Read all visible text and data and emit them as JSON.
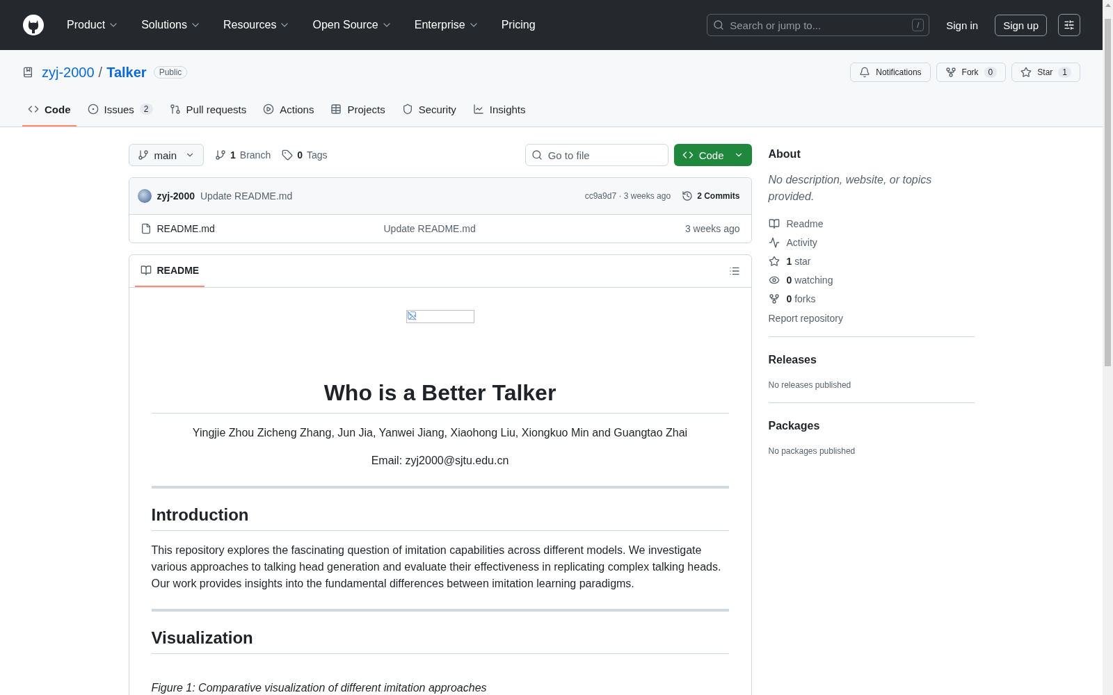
{
  "top_nav": {
    "items": [
      {
        "label": "Product",
        "dropdown": true
      },
      {
        "label": "Solutions",
        "dropdown": true
      },
      {
        "label": "Resources",
        "dropdown": true
      },
      {
        "label": "Open Source",
        "dropdown": true
      },
      {
        "label": "Enterprise",
        "dropdown": true
      },
      {
        "label": "Pricing",
        "dropdown": false
      }
    ],
    "search": {
      "placeholder": "Search or jump to...",
      "shortcut": "/"
    },
    "sign_in": "Sign in",
    "sign_up": "Sign up"
  },
  "repo": {
    "owner": "zyj-2000",
    "separator": "/",
    "name": "Talker",
    "visibility": "Public",
    "actions": [
      {
        "kind": "notifications",
        "label": "Notifications"
      },
      {
        "kind": "fork",
        "label": "Fork",
        "count": "0"
      },
      {
        "kind": "star",
        "label": "Star",
        "count": "1"
      }
    ],
    "tabs": [
      {
        "kind": "code",
        "label": "Code",
        "selected": true
      },
      {
        "kind": "issues",
        "label": "Issues",
        "count": "2",
        "selected": false
      },
      {
        "kind": "pulls",
        "label": "Pull requests",
        "selected": false
      },
      {
        "kind": "actions",
        "label": "Actions",
        "selected": false
      },
      {
        "kind": "projects",
        "label": "Projects",
        "selected": false
      },
      {
        "kind": "security",
        "label": "Security",
        "selected": false
      },
      {
        "kind": "insights",
        "label": "Insights",
        "selected": false
      }
    ]
  },
  "file_nav": {
    "branch": "main",
    "branches": {
      "count": "1",
      "label": "Branch"
    },
    "tags": {
      "count": "0",
      "label": "Tags"
    },
    "go_to_file": {
      "placeholder": "Go to file"
    },
    "code_button": "Code"
  },
  "latest_commit": {
    "author": "zyj-2000",
    "message": "Update README.md",
    "hash": "cc9a9d7",
    "separator": "·",
    "time": "3 weeks ago",
    "commits": "2 Commits"
  },
  "files": [
    {
      "name": "README.md",
      "message": "Update README.md",
      "time": "3 weeks ago"
    }
  ],
  "readme": {
    "tab": "README",
    "title": "Who is a Better Talker",
    "authors": "Yingjie Zhou Zicheng Zhang, Jun Jia, Yanwei Jiang, Xiaohong Liu, Xiongkuo Min and Guangtao Zhai",
    "email": "Email: zyj2000@sjtu.edu.cn",
    "sections": [
      {
        "heading": "Introduction",
        "body": "This repository explores the fascinating question of imitation capabilities across different models. We investigate various approaches to talking head generation and evaluate their effectiveness in replicating complex talking heads. Our work provides insights into the fundamental differences between imitation learning paradigms."
      },
      {
        "heading": "Visualization",
        "caption": "Figure 1: Comparative visualization of different imitation approaches"
      }
    ]
  },
  "sidebar": {
    "about": {
      "heading": "About",
      "description": "No description, website, or topics provided.",
      "links": [
        {
          "kind": "readme",
          "label": "Readme"
        },
        {
          "kind": "activity",
          "label": "Activity"
        },
        {
          "kind": "star",
          "count": "1",
          "label": "star"
        },
        {
          "kind": "watch",
          "count": "0",
          "label": "watching"
        },
        {
          "kind": "fork",
          "count": "0",
          "label": "forks"
        }
      ],
      "report": "Report repository"
    },
    "sections": [
      {
        "heading": "Releases",
        "note": "No releases published"
      },
      {
        "heading": "Packages",
        "note": "No packages published"
      }
    ]
  }
}
